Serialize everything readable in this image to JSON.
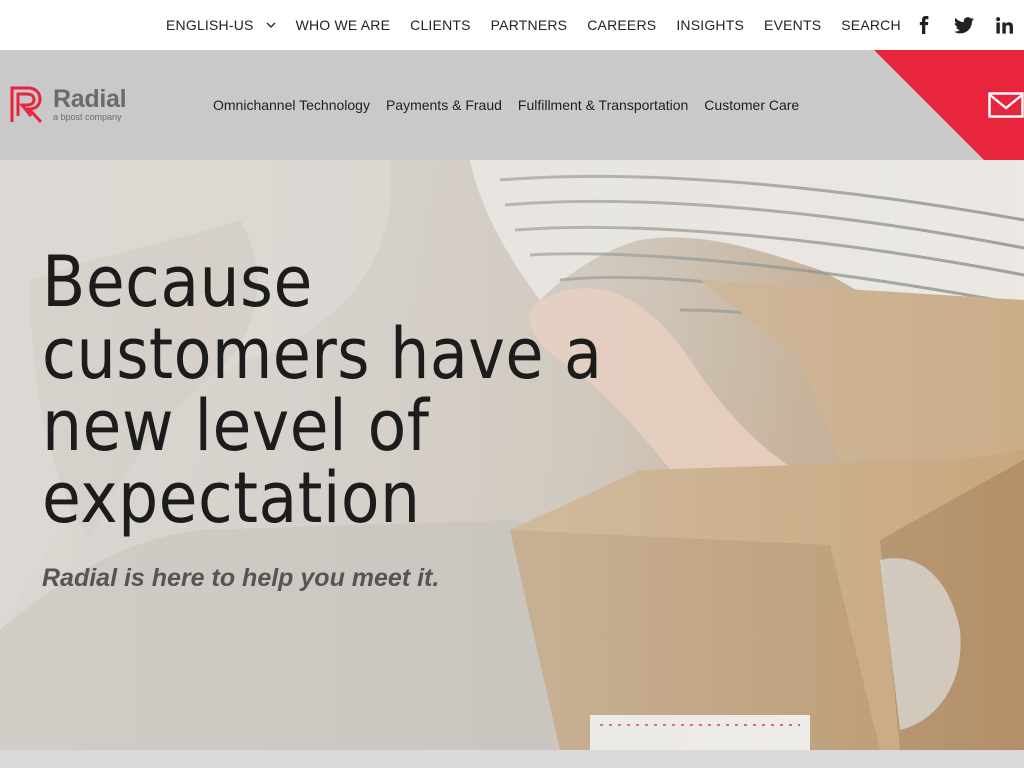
{
  "topbar": {
    "language": "ENGLISH-US",
    "links": [
      "WHO WE ARE",
      "CLIENTS",
      "PARTNERS",
      "CAREERS",
      "INSIGHTS",
      "EVENTS",
      "SEARCH"
    ],
    "social": [
      "facebook-icon",
      "twitter-icon",
      "linkedin-icon"
    ]
  },
  "header": {
    "logo_name": "Radial",
    "logo_sub": "a bpost company",
    "nav": [
      "Omnichannel Technology",
      "Payments & Fraud",
      "Fulfillment & Transportation",
      "Customer Care"
    ],
    "accent_color": "#e8253c",
    "contact_icon": "mail-icon"
  },
  "hero": {
    "headline_lines": [
      "Because",
      "customers have a",
      "new level of",
      "expectation"
    ],
    "tagline": "Radial is here to help you meet it."
  }
}
